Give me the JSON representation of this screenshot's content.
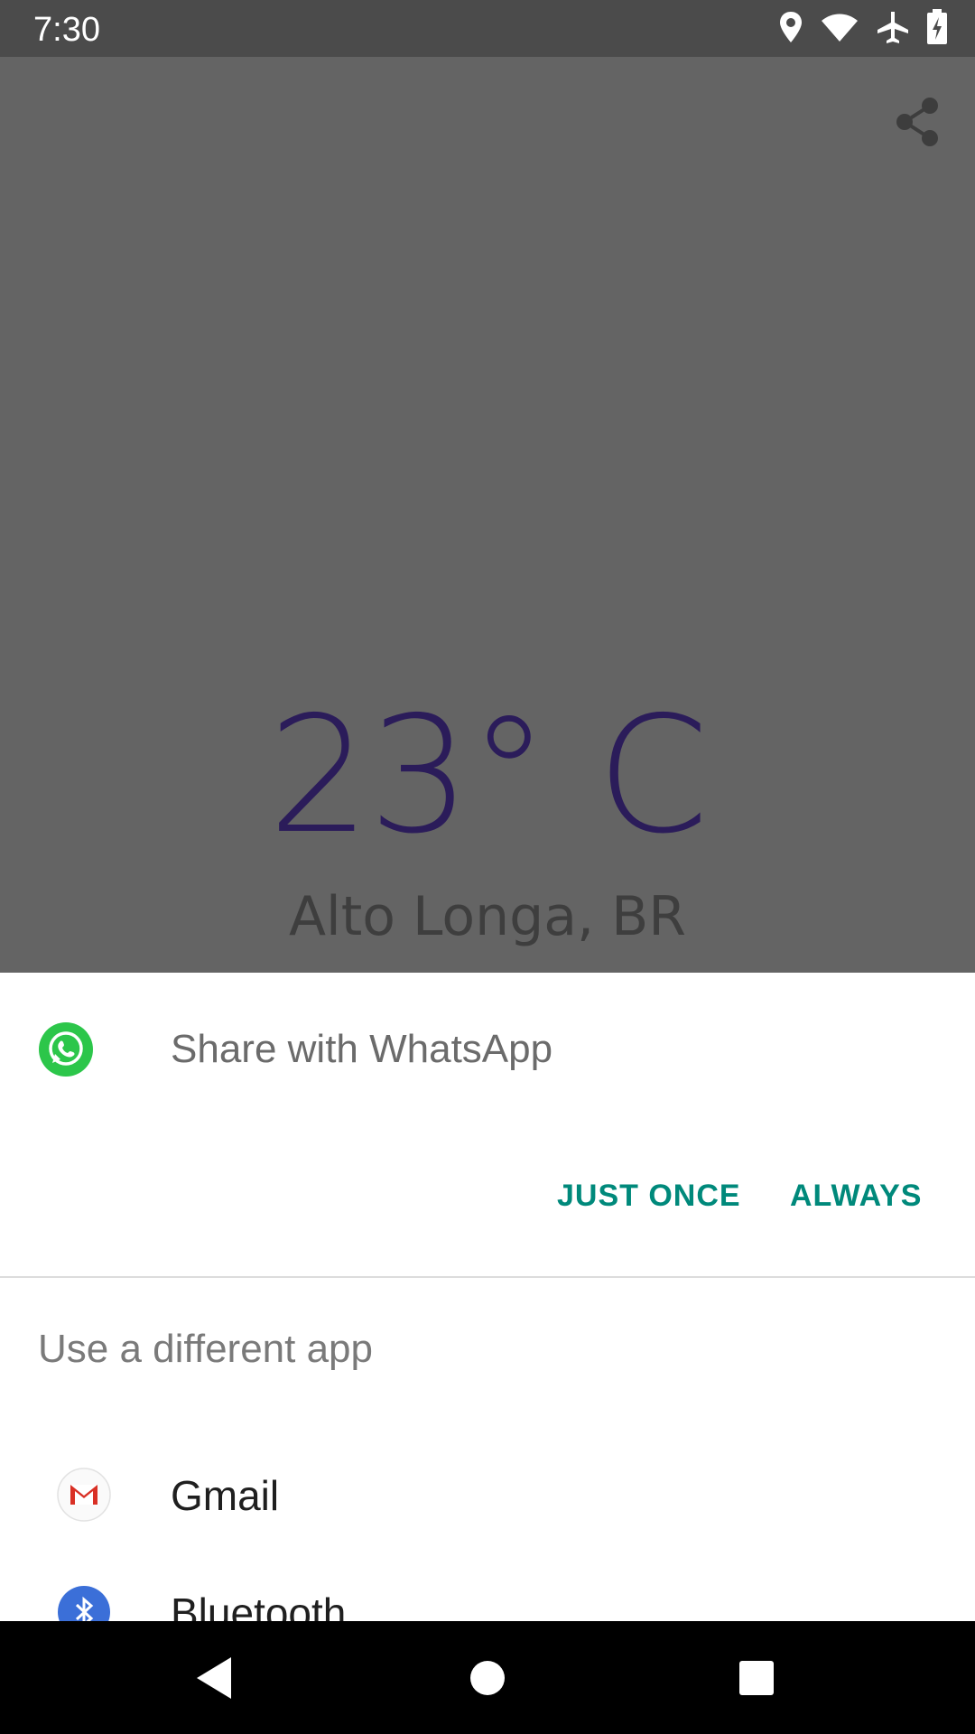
{
  "status_bar": {
    "time": "7:30",
    "icons": [
      "location-icon",
      "wifi-icon",
      "airplane-mode-icon",
      "battery-charging-icon"
    ]
  },
  "weather": {
    "temperature": "23° C",
    "location": "Alto Longa, BR",
    "temperature_color": "#2b1c5a"
  },
  "share_sheet": {
    "suggested_app_title": "Share with WhatsApp",
    "suggested_app_icon": "whatsapp-icon",
    "just_once_label": "JUST ONCE",
    "always_label": "ALWAYS",
    "button_color": "#00897b",
    "different_app_title": "Use a different app",
    "apps": [
      {
        "label": "Gmail",
        "icon": "gmail-icon"
      },
      {
        "label": "Bluetooth",
        "icon": "bluetooth-icon"
      }
    ]
  },
  "nav_bar": {
    "icons": [
      "back-icon",
      "home-icon",
      "recents-icon"
    ]
  }
}
